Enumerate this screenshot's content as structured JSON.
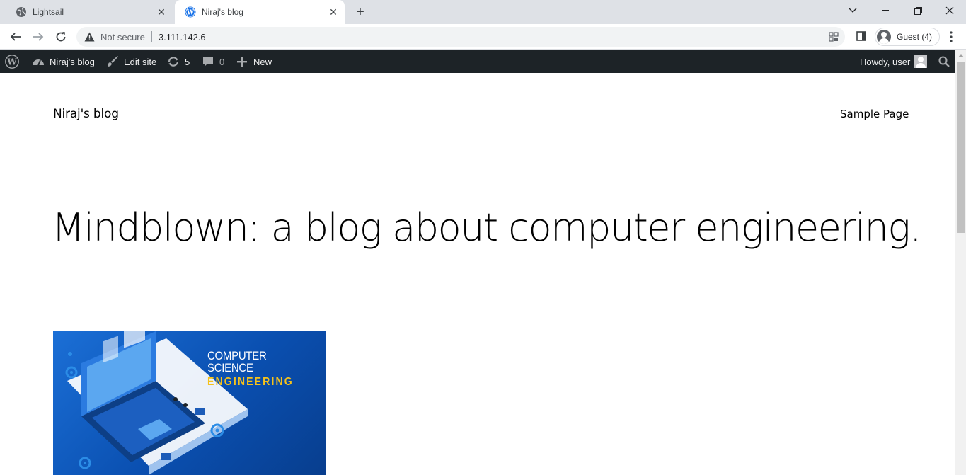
{
  "browser": {
    "tabs": [
      {
        "title": "Lightsail",
        "active": false,
        "favicon": "globe-icon"
      },
      {
        "title": "Niraj's blog",
        "active": true,
        "favicon": "wordpress-icon"
      }
    ],
    "address_bar": {
      "security_label": "Not secure",
      "url": "3.111.142.6"
    },
    "profile_label": "Guest (4)"
  },
  "admin_bar": {
    "site_name": "Niraj's blog",
    "edit_site": "Edit site",
    "updates_count": "5",
    "comments_count": "0",
    "new_label": "New",
    "howdy": "Howdy, user"
  },
  "page": {
    "site_title": "Niraj's blog",
    "nav": [
      "Sample Page"
    ],
    "headline": "Mindblown: a blog about computer engineering.",
    "featured_image": {
      "line1": "COMPUTER SCIENCE",
      "line2": "ENGINEERING"
    }
  },
  "colors": {
    "admin_bar_bg": "#1d2327",
    "tab_strip_bg": "#dee1e6",
    "image_blue": "#0a4fb0",
    "image_accent": "#f5c21b"
  }
}
